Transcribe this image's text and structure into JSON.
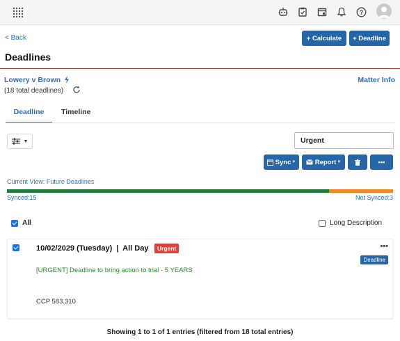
{
  "header": {
    "icons": [
      "apps-grid-icon",
      "robot-icon",
      "clipboard-icon",
      "calendar-icon",
      "bell-icon",
      "help-icon",
      "user-avatar-icon"
    ]
  },
  "nav": {
    "back_label": "< Back",
    "calculate_label": "+ Calculate",
    "deadline_label": "+ Deadline"
  },
  "page": {
    "title": "Deadlines"
  },
  "matter": {
    "name": "Lowery v Brown",
    "total": "(18 total deadlines)",
    "info_link": "Matter Info"
  },
  "tabs": [
    {
      "label": "Deadline",
      "active": true
    },
    {
      "label": "Timeline",
      "active": false
    }
  ],
  "search": {
    "value": "Urgent"
  },
  "actions": {
    "sync_label": "Sync",
    "report_label": "Report",
    "more_label": "•••"
  },
  "view": {
    "current": "Current View: Future Deadlines",
    "synced": "Synced:15",
    "not_synced": "Not Synced:3",
    "synced_count": 15,
    "not_synced_count": 3
  },
  "list_controls": {
    "all_label": "All",
    "all_checked": true,
    "long_desc_label": "Long Description",
    "long_desc_checked": false
  },
  "entries": [
    {
      "date_line": "10/02/2029 (Tuesday)  |  All Day",
      "badge": "Urgent",
      "type": "Deadline",
      "menu": "•••",
      "description": "[URGENT] Deadline to bring action to trial - 5 YEARS",
      "code": "CCP 583.310",
      "checked": true
    }
  ],
  "footer": {
    "summary": "Showing 1 to 1 of 1 entries (filtered from 18 total entries)"
  },
  "colors": {
    "primary": "#2665a6",
    "link": "#2a6fbb",
    "urgent": "#d9433b",
    "synced_bar": "#1f7a3a",
    "not_synced_bar": "#f0882a"
  }
}
